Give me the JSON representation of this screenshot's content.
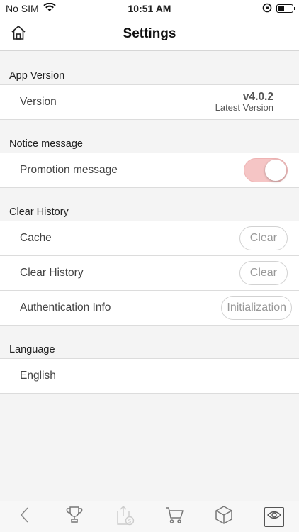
{
  "status_bar": {
    "carrier": "No SIM",
    "time": "10:51 AM"
  },
  "nav": {
    "title": "Settings",
    "home_icon": "home-icon"
  },
  "sections": {
    "app_version": {
      "header": "App Version",
      "version_label": "Version",
      "version_value": "v4.0.2",
      "version_status": "Latest Version"
    },
    "notice": {
      "header": "Notice message",
      "promotion_label": "Promotion message",
      "promotion_enabled": true,
      "toggle_color": "#f5c5c5"
    },
    "clear_history": {
      "header": "Clear History",
      "cache_label": "Cache",
      "cache_button": "Clear",
      "history_label": "Clear History",
      "history_button": "Clear",
      "auth_label": "Authentication Info",
      "auth_button": "Initialization"
    },
    "language": {
      "header": "Language",
      "value": "English"
    }
  },
  "tab_bar": {
    "icons": [
      "back-chevron-icon",
      "trophy-icon",
      "upload-coin-icon",
      "cart-icon",
      "box-icon",
      "eye-icon"
    ]
  }
}
